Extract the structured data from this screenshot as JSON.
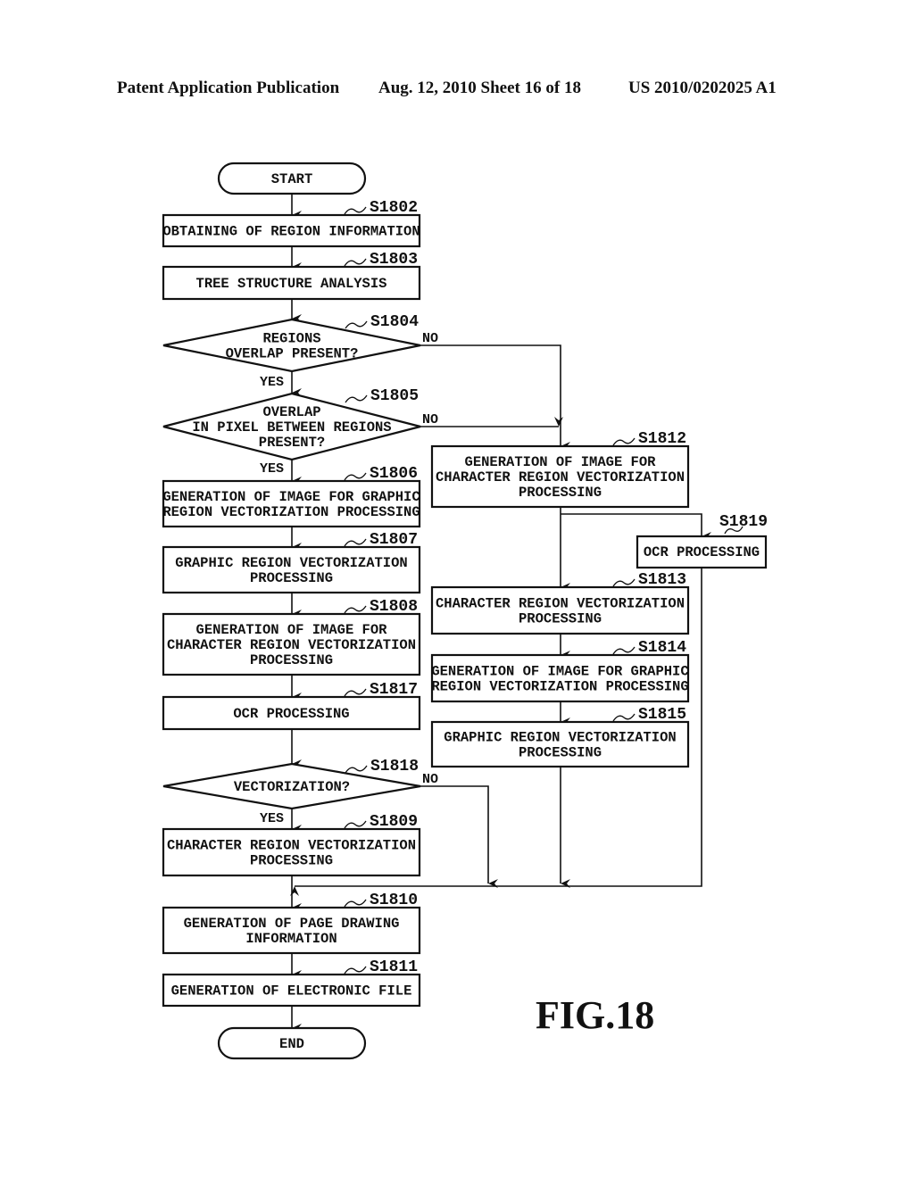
{
  "header": {
    "publication": "Patent Application Publication",
    "date_sheet": "Aug. 12, 2010  Sheet 16 of 18",
    "number": "US 2010/0202025 A1"
  },
  "figure_label": "FIG.18",
  "flow": {
    "start": "START",
    "end": "END",
    "yes": "YES",
    "no": "NO",
    "steps": {
      "s1802": {
        "id": "S1802",
        "lines": [
          "OBTAINING OF REGION INFORMATION"
        ]
      },
      "s1803": {
        "id": "S1803",
        "lines": [
          "TREE STRUCTURE ANALYSIS"
        ]
      },
      "s1804": {
        "id": "S1804",
        "lines": [
          "REGIONS",
          "OVERLAP PRESENT?"
        ]
      },
      "s1805": {
        "id": "S1805",
        "lines": [
          "OVERLAP",
          "IN PIXEL BETWEEN REGIONS",
          "PRESENT?"
        ]
      },
      "s1806": {
        "id": "S1806",
        "lines": [
          "GENERATION OF IMAGE FOR GRAPHIC",
          "REGION VECTORIZATION PROCESSING"
        ]
      },
      "s1807": {
        "id": "S1807",
        "lines": [
          "GRAPHIC REGION VECTORIZATION",
          "PROCESSING"
        ]
      },
      "s1808": {
        "id": "S1808",
        "lines": [
          "GENERATION OF IMAGE FOR",
          "CHARACTER REGION VECTORIZATION",
          "PROCESSING"
        ]
      },
      "s1817": {
        "id": "S1817",
        "lines": [
          "OCR PROCESSING"
        ]
      },
      "s1818": {
        "id": "S1818",
        "lines": [
          "VECTORIZATION?"
        ]
      },
      "s1809": {
        "id": "S1809",
        "lines": [
          "CHARACTER REGION VECTORIZATION",
          "PROCESSING"
        ]
      },
      "s1810": {
        "id": "S1810",
        "lines": [
          "GENERATION OF PAGE DRAWING",
          "INFORMATION"
        ]
      },
      "s1811": {
        "id": "S1811",
        "lines": [
          "GENERATION OF ELECTRONIC FILE"
        ]
      },
      "s1812": {
        "id": "S1812",
        "lines": [
          "GENERATION OF IMAGE FOR",
          "CHARACTER REGION VECTORIZATION",
          "PROCESSING"
        ]
      },
      "s1819": {
        "id": "S1819",
        "lines": [
          "OCR PROCESSING"
        ]
      },
      "s1813": {
        "id": "S1813",
        "lines": [
          "CHARACTER REGION VECTORIZATION",
          "PROCESSING"
        ]
      },
      "s1814": {
        "id": "S1814",
        "lines": [
          "GENERATION OF IMAGE FOR GRAPHIC",
          "REGION VECTORIZATION PROCESSING"
        ]
      },
      "s1815": {
        "id": "S1815",
        "lines": [
          "GRAPHIC REGION VECTORIZATION",
          "PROCESSING"
        ]
      }
    }
  }
}
